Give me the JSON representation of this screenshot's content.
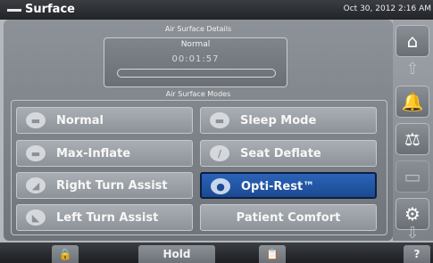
{
  "header": {
    "title": "Surface",
    "datetime": "Oct 30, 2012 2:16 AM"
  },
  "details": {
    "heading": "Air Surface Details",
    "mode": "Normal",
    "timer": "00:01:57"
  },
  "modes": {
    "heading": "Air Surface Modes",
    "buttons": [
      {
        "label": "Normal",
        "icon": "bed-icon",
        "selected": false
      },
      {
        "label": "Sleep Mode",
        "icon": "sleep-icon",
        "selected": false
      },
      {
        "label": "Max-Inflate",
        "icon": "inflate-icon",
        "selected": false
      },
      {
        "label": "Seat Deflate",
        "icon": "deflate-icon",
        "selected": false
      },
      {
        "label": "Right Turn Assist",
        "icon": "right-turn-icon",
        "selected": false
      },
      {
        "label": "Opti-Rest™",
        "icon": "opti-rest-icon",
        "selected": true
      },
      {
        "label": "Left Turn Assist",
        "icon": "left-turn-icon",
        "selected": false
      },
      {
        "label": "Patient Comfort",
        "icon": "",
        "selected": false
      }
    ]
  },
  "footer": {
    "hold_label": "Hold",
    "help_label": "?"
  },
  "colors": {
    "selected": "#1f4f9a",
    "header": "#2b2e33"
  }
}
